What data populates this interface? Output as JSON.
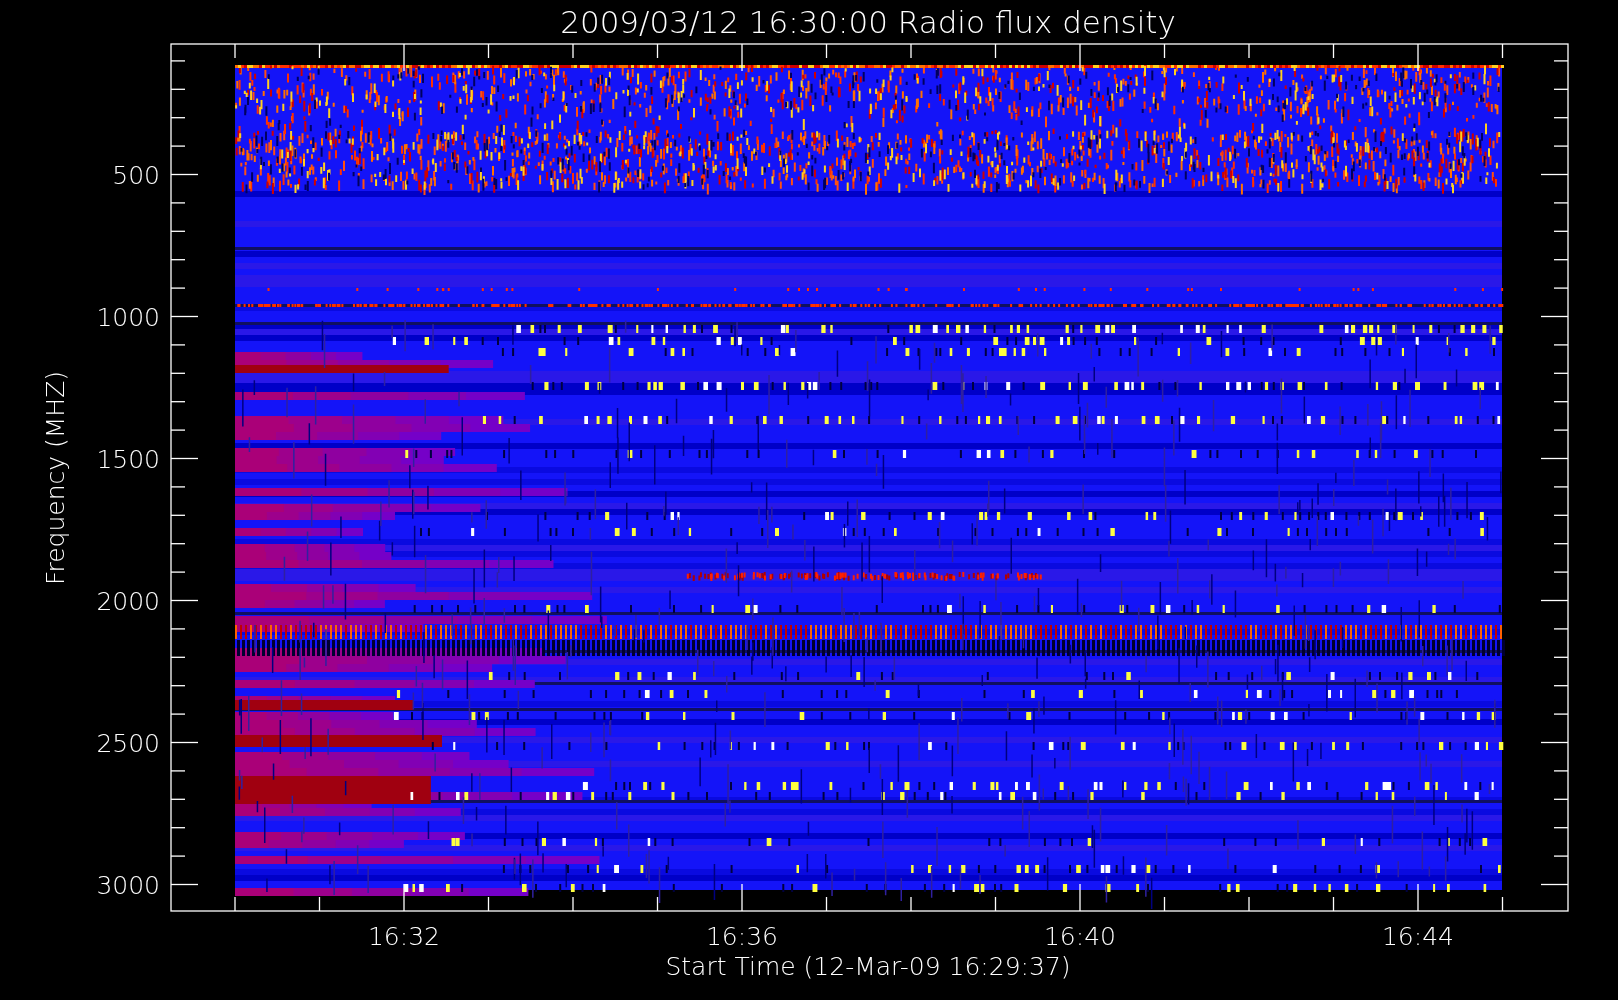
{
  "title": "2009/03/12 16:30:00 Radio flux density",
  "plot": {
    "ylabel": "Frequency (MHZ)",
    "xlabel": "Start Time (12-Mar-09 16:29:37)",
    "yticks": [
      "500",
      "1000",
      "1500",
      "2000",
      "2500",
      "3000"
    ],
    "xticks": [
      "16:32",
      "16:36",
      "16:40",
      "16:44"
    ]
  }
}
